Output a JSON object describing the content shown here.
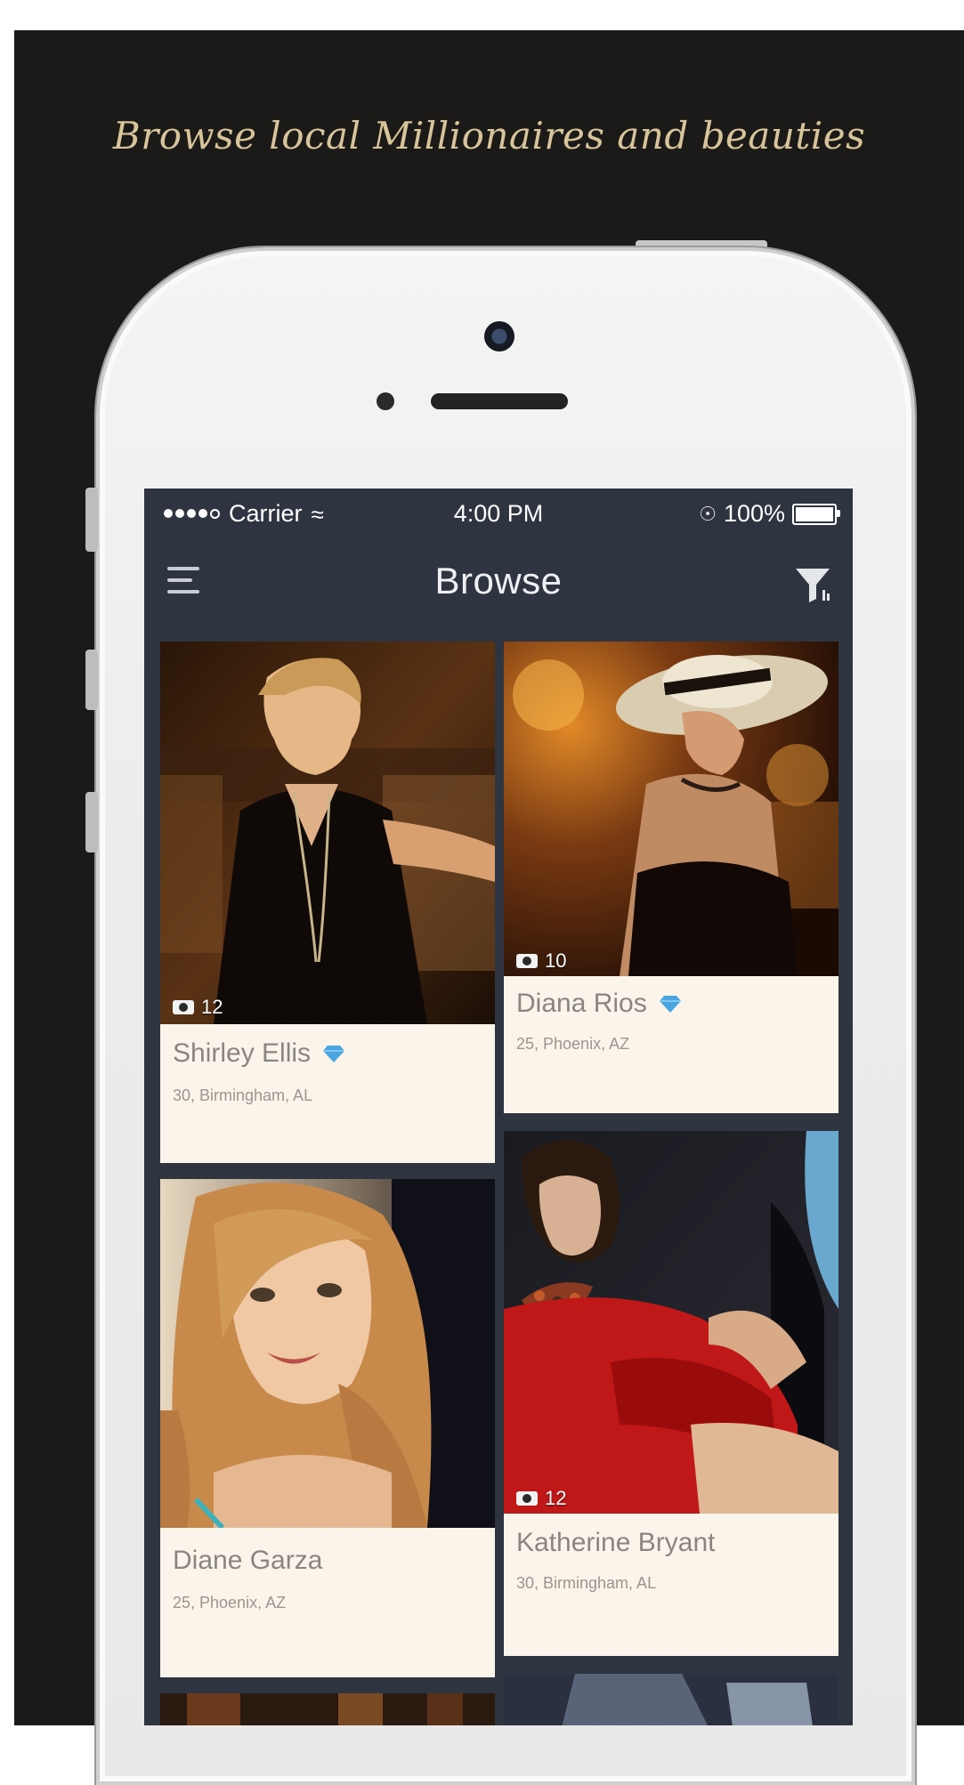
{
  "tagline": "Browse local Millionaires and beauties",
  "status_bar": {
    "carrier": "Carrier",
    "time": "4:00 PM",
    "battery": "100%"
  },
  "nav": {
    "title": "Browse",
    "menu_icon": "hamburger-menu-icon",
    "filter_icon": "funnel-filter-icon"
  },
  "profiles": [
    {
      "name": "Shirley Ellis",
      "details": "30, Birmingham, AL",
      "photo_count": "12",
      "verified": true
    },
    {
      "name": "Diana Rios",
      "details": "25, Phoenix, AZ",
      "photo_count": "10",
      "verified": true
    },
    {
      "name": "Diane Garza",
      "details": "25, Phoenix, AZ",
      "photo_count": "",
      "verified": false
    },
    {
      "name": "Katherine Bryant",
      "details": "30, Birmingham, AL",
      "photo_count": "12",
      "verified": false
    }
  ],
  "colors": {
    "backdrop": "#1b1a18",
    "tagline": "#d8c49a",
    "screen": "#2e3440",
    "card": "#fbf4ea",
    "diamond": "#4aa6e0"
  }
}
